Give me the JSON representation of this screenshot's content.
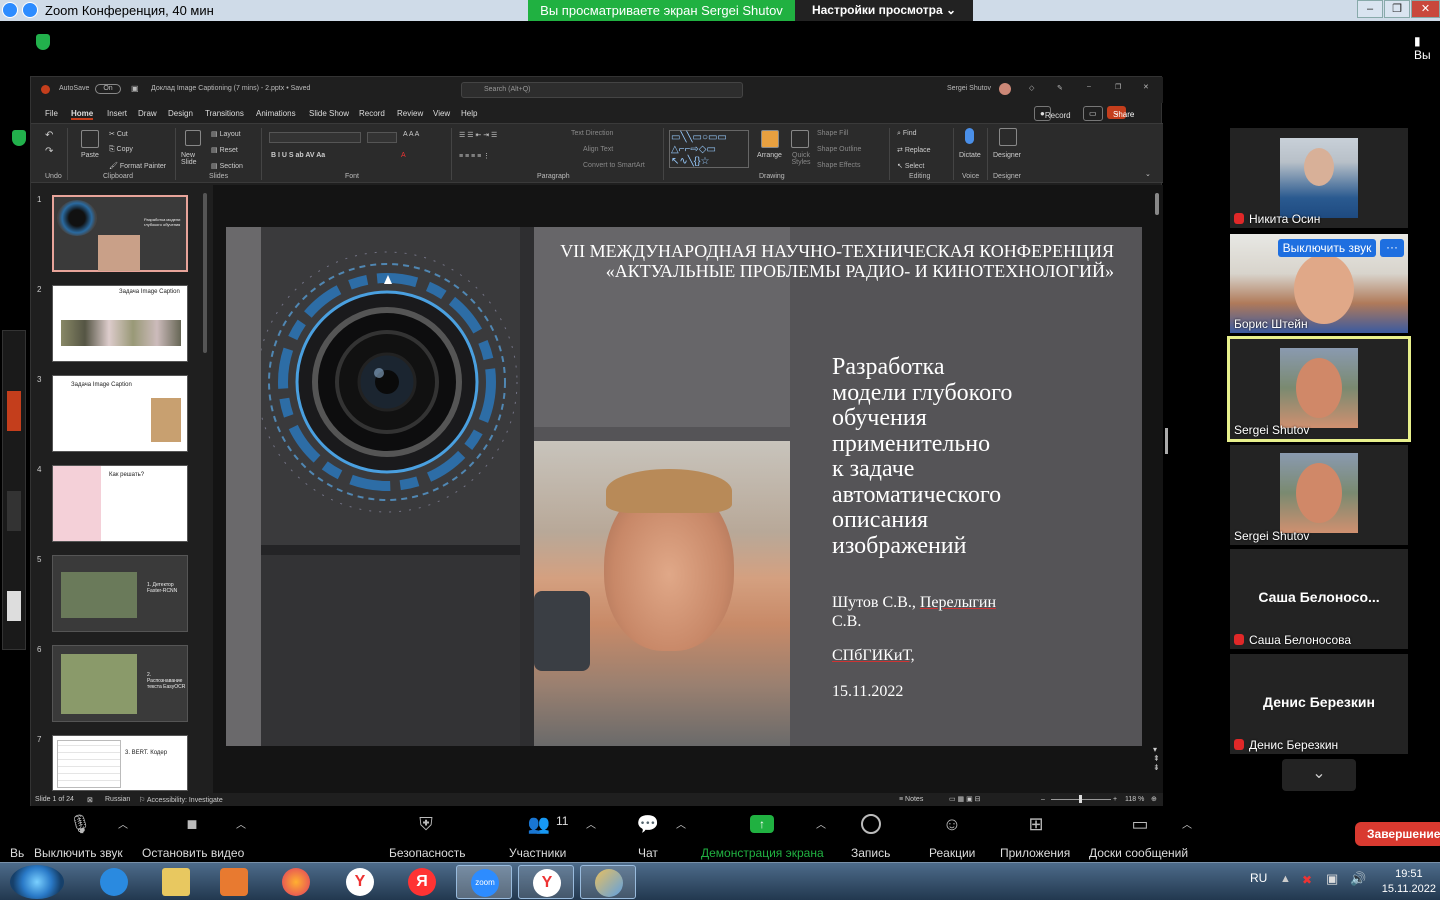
{
  "zoom": {
    "title": "Zoom Конференция, 40 мин",
    "viewing_banner": "Вы просматриваете экран Sergei Shutov",
    "view_settings": "Настройки просмотра",
    "right_label": "Вы"
  },
  "ppt": {
    "autosave": "AutoSave",
    "autosave_state": "On",
    "filename": "Доклад Image Captioning (7 mins) - 2.pptx • Saved",
    "search_placeholder": "Search (Alt+Q)",
    "user": "Sergei Shutov",
    "menu": [
      "File",
      "Home",
      "Insert",
      "Draw",
      "Design",
      "Transitions",
      "Animations",
      "Slide Show",
      "Record",
      "Review",
      "View",
      "Help"
    ],
    "record_btn": "Record",
    "share_btn": "Share",
    "ribbon": {
      "undo_group": "Undo",
      "paste": "Paste",
      "cut": "Cut",
      "copy": "Copy",
      "format_painter": "Format Painter",
      "clipboard_group": "Clipboard",
      "new_slide": "New Slide",
      "layout": "Layout",
      "reset": "Reset",
      "section": "Section",
      "slides_group": "Slides",
      "font_group": "Font",
      "text_direction": "Text Direction",
      "align_text": "Align Text",
      "convert_smartart": "Convert to SmartArt",
      "paragraph_group": "Paragraph",
      "arrange": "Arrange",
      "quick_styles": "Quick Styles",
      "shape_fill": "Shape Fill",
      "shape_outline": "Shape Outline",
      "shape_effects": "Shape Effects",
      "drawing_group": "Drawing",
      "find": "Find",
      "replace": "Replace",
      "select": "Select",
      "editing_group": "Editing",
      "dictate": "Dictate",
      "voice_group": "Voice",
      "designer": "Designer",
      "designer_group": "Designer"
    },
    "thumbnails": [
      {
        "num": "1",
        "title": "Разработка модели глубокого обучения",
        "dark": true
      },
      {
        "num": "2",
        "title": "Задача Image Caption",
        "dark": false
      },
      {
        "num": "3",
        "title": "Задача Image Caption",
        "dark": false
      },
      {
        "num": "4",
        "title": "Как решать?",
        "dark": false
      },
      {
        "num": "5",
        "title": "1. Детектор Faster-RCNN",
        "dark": true
      },
      {
        "num": "6",
        "title": "2. Распознавание текста EasyOCR",
        "dark": true
      },
      {
        "num": "7",
        "title": "3. BERT. Кодер",
        "dark": false
      }
    ],
    "slide": {
      "conference_line1": "VII МЕЖДУНАРОДНАЯ НАУЧНО-ТЕХНИЧЕСКАЯ КОНФЕРЕНЦИЯ",
      "conference_line2": "«АКТУАЛЬНЫЕ ПРОБЛЕМЫ РАДИО- И КИНОТЕХНОЛОГИЙ»",
      "title_lines": [
        "Разработка",
        "модели глубокого",
        "обучения",
        "применительно",
        "к задаче",
        "автоматического",
        "описания",
        "изображений"
      ],
      "authors_a": "Шутов С.В., ",
      "authors_b": "Перелыгин",
      "authors_c": "С.В.",
      "org": "СПбГИКиТ,",
      "date": "15.11.2022"
    },
    "status": {
      "slide_of": "Slide 1 of 24",
      "language": "Russian",
      "accessibility": "Accessibility: Investigate",
      "notes": "Notes",
      "zoom": "118 %"
    }
  },
  "participants": [
    {
      "name": "Никита Осин",
      "muted": true,
      "video": true
    },
    {
      "name": "Борис Штейн",
      "muted": false,
      "video": true,
      "unmute_btn": "Выключить звук"
    },
    {
      "name": "Sergei Shutov",
      "muted": false,
      "video": true,
      "active": true
    },
    {
      "name": "Sergei Shutov",
      "muted": false,
      "video": true
    },
    {
      "name": "Саша Белоносова",
      "display": "Саша  Белоносо...",
      "muted": true
    },
    {
      "name": "Денис Березкин",
      "display": "Денис Березкин",
      "muted": true
    }
  ],
  "toolbar": {
    "left_cut": "Вь",
    "mute": "Выключить звук",
    "video": "Остановить видео",
    "security": "Безопасность",
    "participants": "Участники",
    "participants_count": "11",
    "chat": "Чат",
    "share": "Демонстрация экрана",
    "record": "Запись",
    "reactions": "Реакции",
    "apps": "Приложения",
    "whiteboard": "Доски сообщений",
    "end": "Завершение"
  },
  "taskbar": {
    "lang": "RU",
    "time": "19:51",
    "date": "15.11.2022"
  },
  "colors": {
    "zoom_green": "#20b141",
    "zoom_blue": "#2d8cff",
    "ppt_accent": "#c43e1c",
    "end_red": "#d93a30",
    "active_speaker": "#e8f08c"
  }
}
